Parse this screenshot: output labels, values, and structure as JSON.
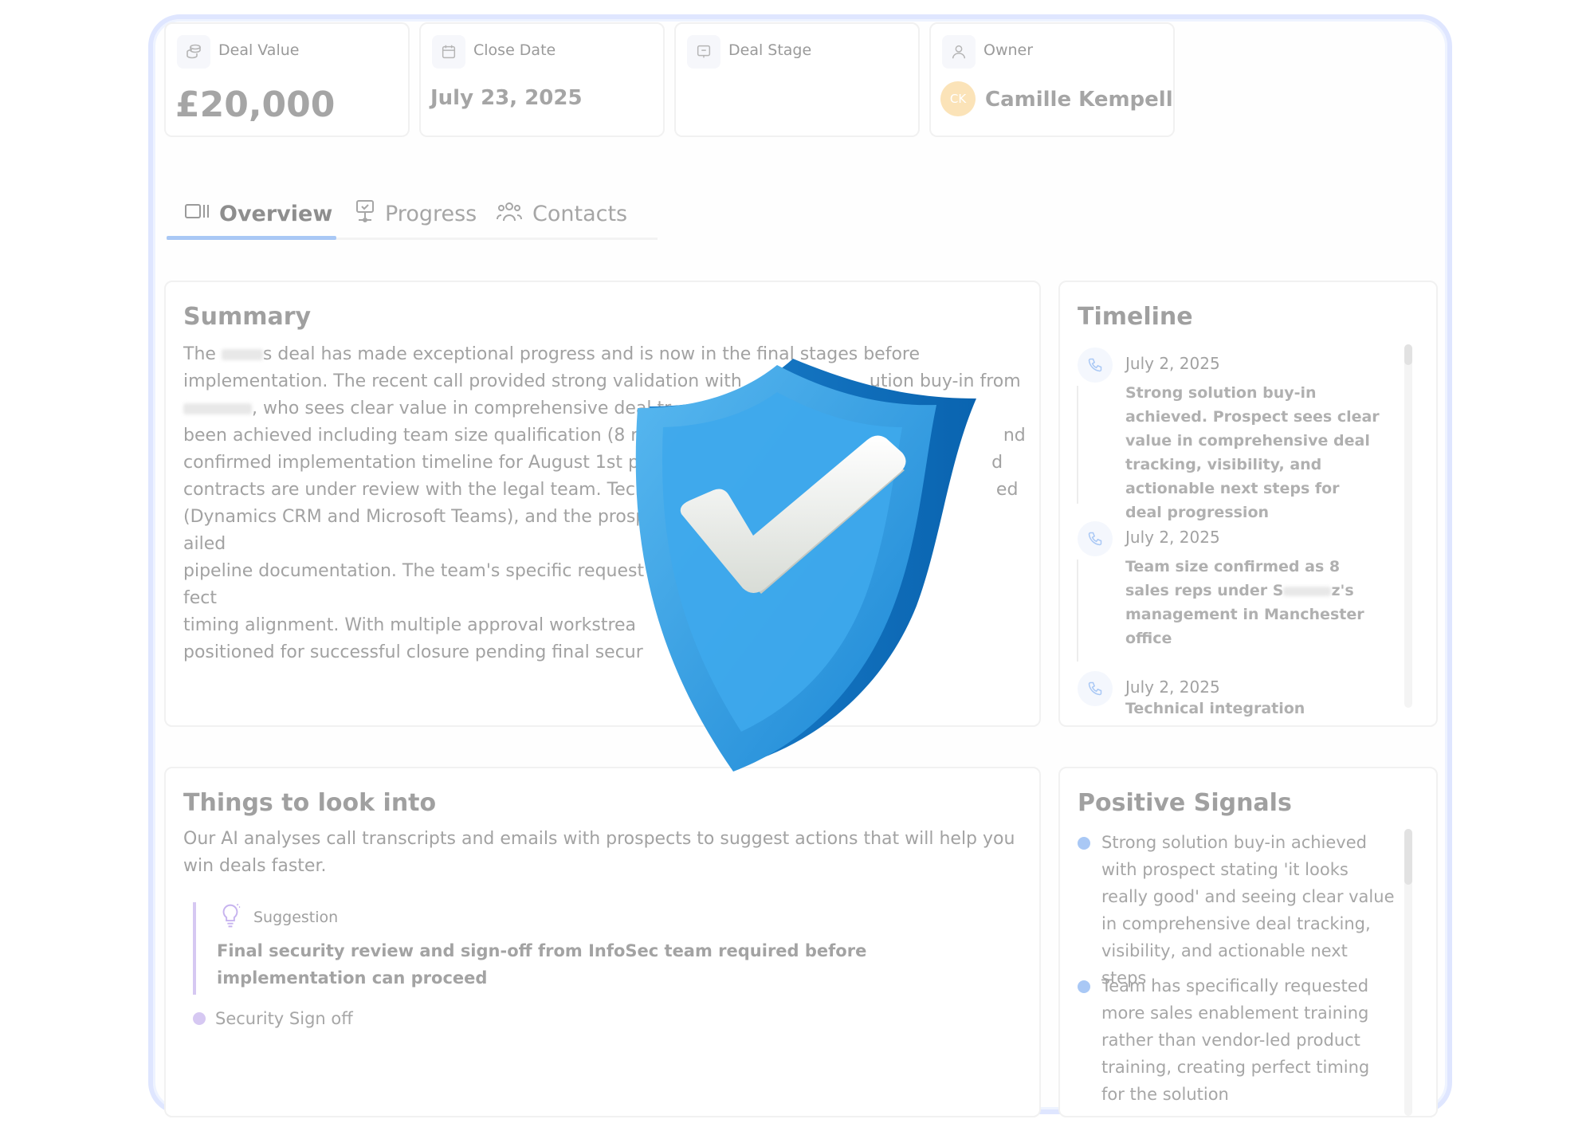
{
  "stats": [
    {
      "label": "Deal Value",
      "value": "£20,000",
      "icon": "coins-icon"
    },
    {
      "label": "Close Date",
      "value": "July 23, 2025",
      "icon": "calendar-icon"
    },
    {
      "label": "Deal Stage",
      "value": "",
      "icon": "stage-icon"
    },
    {
      "label": "Owner",
      "value": "Camille Kempell",
      "icon": "user-icon",
      "initials": "CK"
    }
  ],
  "tabs": [
    {
      "label": "Overview",
      "icon": "overview-icon",
      "active": true
    },
    {
      "label": "Progress",
      "icon": "progress-icon"
    },
    {
      "label": "Contacts",
      "icon": "contacts-icon"
    }
  ],
  "summary": {
    "title": "Summary",
    "lines": [
      [
        "The ",
        "s deal has made exceptional progress and is now in the final stages before"
      ],
      [
        "implementation. The recent call provided strong validation with",
        "ution buy-in from"
      ],
      [
        "",
        ", who sees clear value in comprehensive deal tr",
        ""
      ],
      [
        "been achieved including team size qualification (8 reps",
        "nd"
      ],
      [
        "confirmed implementation timeline for August 1st pil",
        "d"
      ],
      [
        "contracts are under review with the legal team. Techr",
        "ed"
      ],
      [
        "(Dynamics CRM and Microsoft Teams), and the prosp",
        "ailed"
      ],
      [
        "pipeline documentation. The team's specific request",
        "fect"
      ],
      [
        "timing alignment. With multiple approval workstrea",
        ""
      ],
      [
        "positioned for successful closure pending final secur",
        ""
      ]
    ]
  },
  "timeline": {
    "title": "Timeline",
    "items": [
      {
        "date": "July 2, 2025",
        "text": "Strong solution buy-in achieved. Prospect sees clear value in comprehensive deal tracking, visibility, and actionable next steps for deal progression"
      },
      {
        "date": "July 2, 2025",
        "text_pre": "Team size confirmed as 8 sales reps under S",
        "text_post": "z's management in Manchester office"
      },
      {
        "date": "July 2, 2025",
        "text": "Technical integration confirmed"
      }
    ]
  },
  "things": {
    "title": "Things to look into",
    "description": "Our AI analyses call transcripts and emails with prospects to suggest actions that will help you win deals faster.",
    "suggestion_label": "Suggestion",
    "suggestion_text": "Final security review and sign-off from InfoSec team required before implementation can proceed",
    "tag": "Security Sign off"
  },
  "signals": {
    "title": "Positive Signals",
    "items": [
      "Strong solution buy-in achieved with prospect stating 'it looks really good' and seeing clear value in comprehensive deal tracking, visibility, and actionable next steps",
      "Team has specifically requested more sales enablement training rather than vendor-led product training, creating perfect timing for the solution"
    ]
  },
  "colors": {
    "accent": "#a9c8f5",
    "shield": "#2a9be6",
    "bullet": "#a9c8f5",
    "suggestion": "#c9b6f0"
  }
}
